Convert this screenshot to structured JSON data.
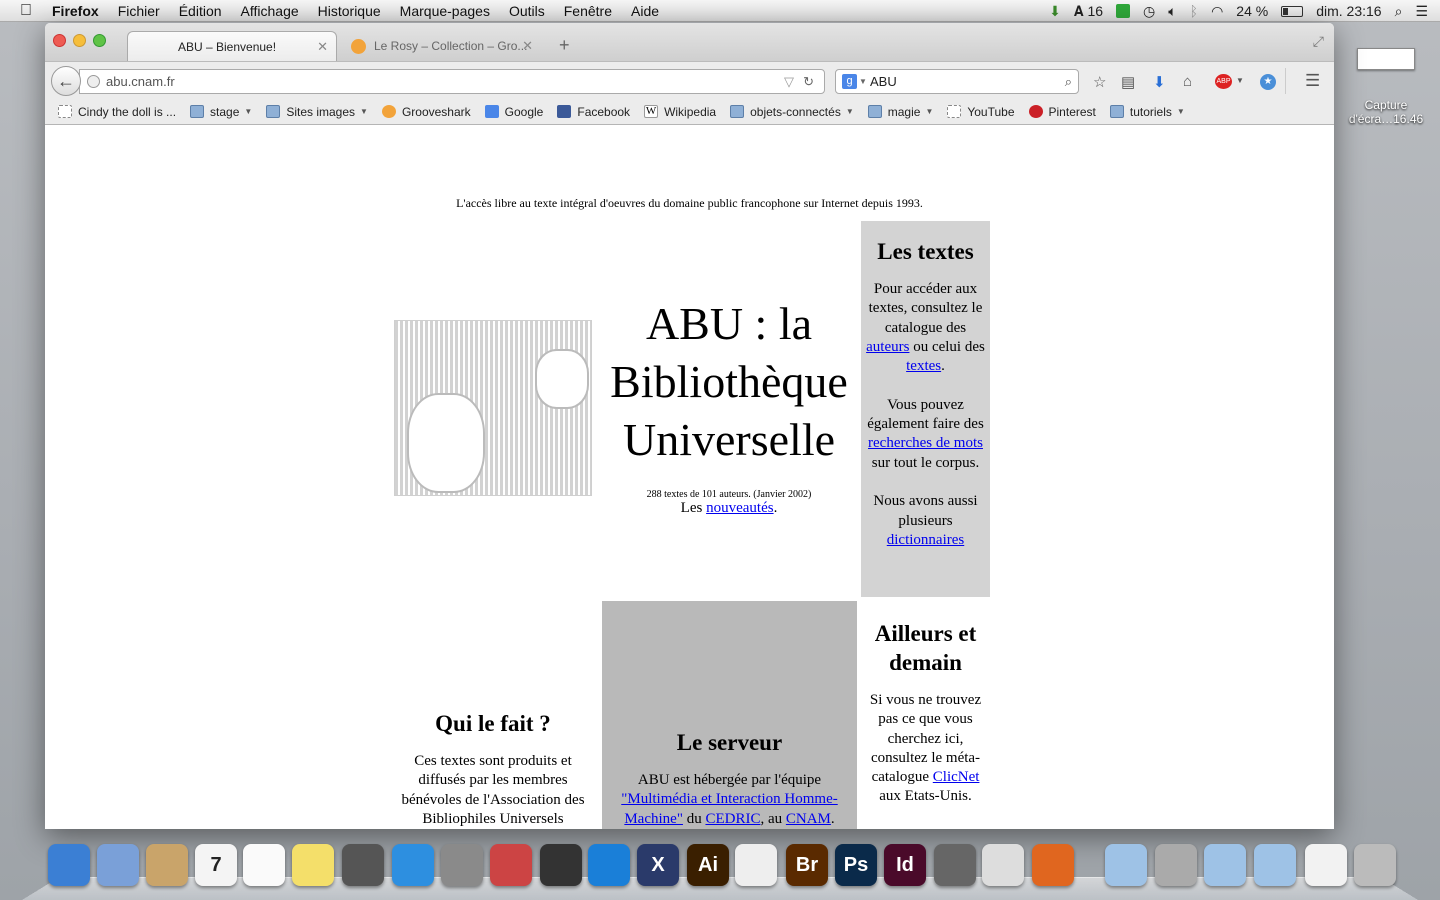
{
  "menubar": {
    "app": "Firefox",
    "items": [
      "Fichier",
      "Édition",
      "Affichage",
      "Historique",
      "Marque-pages",
      "Outils",
      "Fenêtre",
      "Aide"
    ],
    "status": {
      "adobe_count": "16",
      "battery": "24 %",
      "clock": "dim. 23:16"
    }
  },
  "desktop": {
    "screenshot_label": "Capture d'écra…16.46"
  },
  "tabs": [
    {
      "title": "ABU – Bienvenue!"
    },
    {
      "title": "Le Rosy – Collection – Gro..."
    }
  ],
  "nav": {
    "url": "abu.cnam.fr",
    "search": "ABU"
  },
  "bookmarks": [
    {
      "label": "Cindy the doll is ..."
    },
    {
      "label": "stage"
    },
    {
      "label": "Sites images"
    },
    {
      "label": "Grooveshark"
    },
    {
      "label": "Google"
    },
    {
      "label": "Facebook"
    },
    {
      "label": "Wikipedia"
    },
    {
      "label": "objets-connectés"
    },
    {
      "label": "magie"
    },
    {
      "label": "YouTube"
    },
    {
      "label": "Pinterest"
    },
    {
      "label": "tutoriels"
    }
  ],
  "page": {
    "tagline": "L'accès libre au texte intégral d'oeuvres du domaine public francophone sur Internet depuis 1993.",
    "title_line1": "ABU : la",
    "title_line2": "Bibliothèque",
    "title_line3": "Universelle",
    "stats": "288 textes de 101 auteurs. (Janvier 2002)",
    "news_prefix": "Les",
    "news_link": "nouveautés",
    "textes": {
      "heading": "Les textes",
      "p1a": "Pour accéder aux textes, consultez le catalogue des",
      "link_auteurs": "auteurs",
      "p1b": "ou celui des",
      "link_textes": "textes",
      "p2a": "Vous pouvez également faire des",
      "link_recherches": "recherches de mots",
      "p2b": "sur tout le corpus.",
      "p3a": "Nous avons aussi plusieurs",
      "link_dictionnaires": "dictionnaires"
    },
    "ailleurs": {
      "heading": "Ailleurs et demain",
      "p1a": "Si vous ne trouvez pas ce que vous cherchez ici, consultez le méta-catalogue",
      "link_clicnet": "ClicNet",
      "p1b": "aux Etats-Unis."
    },
    "serveur": {
      "heading": "Le serveur",
      "p1a": "ABU est hébergée par l'équipe",
      "link_multimedia": "\"Multimédia et Interaction Homme-Machine\"",
      "p1b": "du",
      "link_cedric": "CEDRIC",
      "p1c": ", au",
      "link_cnam": "CNAM"
    },
    "quifait": {
      "heading": "Qui le fait ?",
      "p1": "Ces textes sont produits et diffusés par les membres bénévoles de l'Association des Bibliophiles Universels"
    }
  },
  "dock": {
    "items": [
      {
        "icon": "finder-icon",
        "color": "#3b7fd4"
      },
      {
        "icon": "mail-icon",
        "color": "#7aa0d8"
      },
      {
        "icon": "contacts-icon",
        "color": "#c9a46a"
      },
      {
        "icon": "calendar-icon",
        "color": "#f4f4f4",
        "text": "7"
      },
      {
        "icon": "reminders-icon",
        "color": "#fafafa"
      },
      {
        "icon": "notes-icon",
        "color": "#f4df6a"
      },
      {
        "icon": "photo-icon",
        "color": "#555555"
      },
      {
        "icon": "itunes-icon",
        "color": "#2d8fe0"
      },
      {
        "icon": "system-preferences-icon",
        "color": "#8a8a8a"
      },
      {
        "icon": "app-icon",
        "color": "#c44"
      },
      {
        "icon": "imovie-icon",
        "color": "#333333"
      },
      {
        "icon": "cyberduck-icon",
        "color": "#1a7fd8"
      },
      {
        "icon": "x11-icon",
        "color": "#2a3a6a",
        "text": "X"
      },
      {
        "icon": "illustrator-icon",
        "color": "#3a1f00",
        "text": "Ai"
      },
      {
        "icon": "textedit-icon",
        "color": "#eeeeee"
      },
      {
        "icon": "bridge-icon",
        "color": "#5a2a00",
        "text": "Br"
      },
      {
        "icon": "photoshop-icon",
        "color": "#0a2a4a",
        "text": "Ps"
      },
      {
        "icon": "indesign-icon",
        "color": "#4a0a2a",
        "text": "Id"
      },
      {
        "icon": "screenshot-icon",
        "color": "#666666"
      },
      {
        "icon": "grab-icon",
        "color": "#dddddd"
      },
      {
        "icon": "firefox-icon",
        "color": "#e0661f"
      },
      {
        "icon": "documents-folder-icon",
        "color": "#9ec2e6"
      },
      {
        "icon": "hard-drive-icon",
        "color": "#aaaaaa"
      },
      {
        "icon": "applications-folder-icon",
        "color": "#9ec2e6"
      },
      {
        "icon": "downloads-folder-icon",
        "color": "#9ec2e6"
      },
      {
        "icon": "screenshot-file-icon",
        "color": "#f2f2f2"
      },
      {
        "icon": "trash-icon",
        "color": "#bbbbbb"
      }
    ]
  }
}
